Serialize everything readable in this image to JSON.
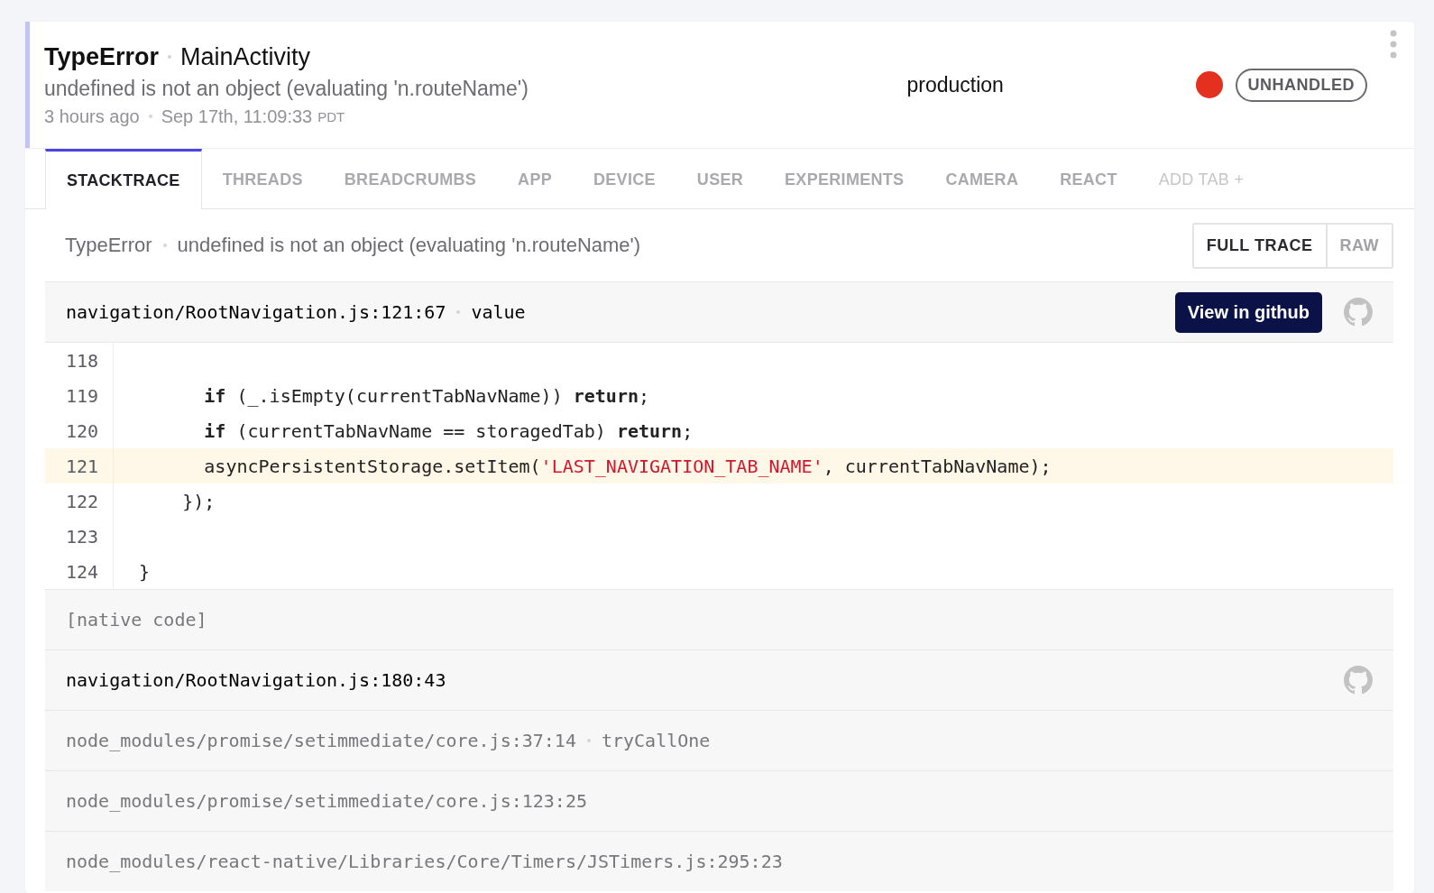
{
  "header": {
    "error_class": "TypeError",
    "context": "MainActivity",
    "message": "undefined is not an object (evaluating 'n.routeName')",
    "relative_time": "3 hours ago",
    "timestamp": "Sep 17th, 11:09:33",
    "timezone": "PDT",
    "stage": "production",
    "status_dot": {
      "color": "#e3301f"
    },
    "handled_badge": "UNHANDLED"
  },
  "tabs": [
    {
      "label": "STACKTRACE",
      "selected": true,
      "disabled": false
    },
    {
      "label": "THREADS",
      "selected": false,
      "disabled": false
    },
    {
      "label": "BREADCRUMBS",
      "selected": false,
      "disabled": false
    },
    {
      "label": "APP",
      "selected": false,
      "disabled": false
    },
    {
      "label": "DEVICE",
      "selected": false,
      "disabled": false
    },
    {
      "label": "USER",
      "selected": false,
      "disabled": false
    },
    {
      "label": "EXPERIMENTS",
      "selected": false,
      "disabled": false
    },
    {
      "label": "CAMERA",
      "selected": false,
      "disabled": false
    },
    {
      "label": "REACT",
      "selected": false,
      "disabled": false
    },
    {
      "label": "ADD TAB +",
      "selected": false,
      "disabled": true
    }
  ],
  "summary": {
    "error_class": "TypeError",
    "message": "undefined is not an object (evaluating 'n.routeName')"
  },
  "view_toggle": [
    {
      "label": "FULL TRACE",
      "selected": true
    },
    {
      "label": "RAW",
      "selected": false
    }
  ],
  "tooltip": "View in github",
  "frames": [
    {
      "kind": "expanded",
      "file": "navigation/RootNavigation.js:121:67",
      "method": "value",
      "in_project": true,
      "github": true,
      "lines": [
        {
          "number": "118",
          "highlighted": false
        },
        {
          "number": "119",
          "highlighted": false,
          "segments": [
            {
              "kind": "keyword",
              "text": "        if"
            },
            {
              "kind": "plain",
              "text": " (_.isEmpty(currentTabNavName)) "
            },
            {
              "kind": "keyword",
              "text": "return"
            },
            {
              "kind": "plain",
              "text": ";"
            }
          ]
        },
        {
          "number": "120",
          "highlighted": false,
          "segments": [
            {
              "kind": "keyword",
              "text": "        if"
            },
            {
              "kind": "plain",
              "text": " (currentTabNavName == storagedTab) "
            },
            {
              "kind": "keyword",
              "text": "return"
            },
            {
              "kind": "plain",
              "text": ";"
            }
          ]
        },
        {
          "number": "121",
          "highlighted": true,
          "segments": [
            {
              "kind": "plain",
              "text": "        asyncPersistentStorage.setItem("
            },
            {
              "kind": "string",
              "text": "'LAST_NAVIGATION_TAB_NAME'"
            },
            {
              "kind": "plain",
              "text": ", currentTabNavName);"
            }
          ]
        },
        {
          "number": "122",
          "highlighted": false,
          "segments": [
            {
              "kind": "plain",
              "text": "      });"
            }
          ]
        },
        {
          "number": "123",
          "highlighted": false
        },
        {
          "number": "124",
          "highlighted": false,
          "segments": [
            {
              "kind": "plain",
              "text": "  }"
            }
          ]
        }
      ]
    },
    {
      "kind": "native",
      "file": "[native code]"
    },
    {
      "kind": "collapsed",
      "file": "navigation/RootNavigation.js:180:43",
      "in_project": true,
      "github": true
    },
    {
      "kind": "collapsed",
      "file": "node_modules/promise/setimmediate/core.js:37:14",
      "method": "tryCallOne",
      "in_project": false,
      "github": false
    },
    {
      "kind": "collapsed",
      "file": "node_modules/promise/setimmediate/core.js:123:25",
      "in_project": false,
      "github": false
    },
    {
      "kind": "collapsed",
      "file": "node_modules/react-native/Libraries/Core/Timers/JSTimers.js:295:23",
      "in_project": false,
      "github": false
    }
  ]
}
